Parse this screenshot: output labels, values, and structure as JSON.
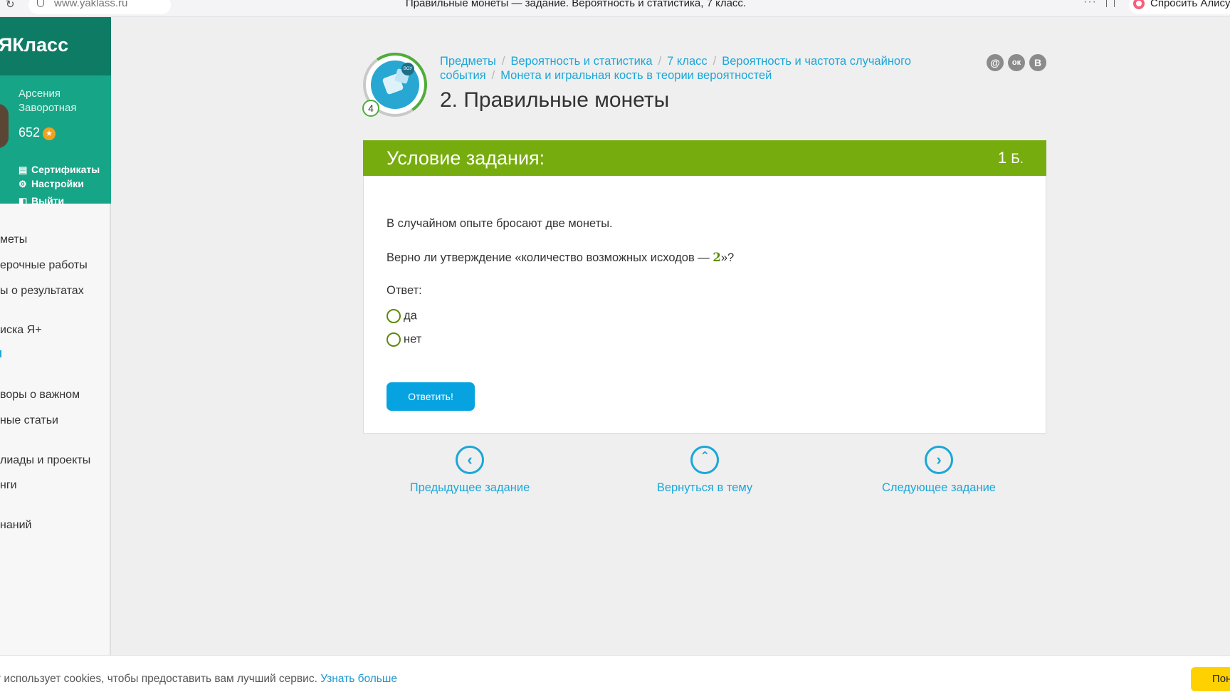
{
  "browser": {
    "url": "www.yaklass.ru",
    "tab_title": "Правильные монеты — задание. Вероятность и статистика, 7 класс.",
    "alice_label": "Спросить Алису"
  },
  "sidebar": {
    "logo": "ЯКласс",
    "user_name": "Арсения Заворотная",
    "points": "652",
    "links": [
      {
        "label": "Сертификаты",
        "icon": "certificate-icon"
      },
      {
        "label": "Настройки",
        "icon": "gear-icon"
      },
      {
        "label": "Выйти",
        "icon": "logout-icon"
      }
    ],
    "nav": [
      "меты",
      "ерочные работы",
      "ы о результатах",
      "иска Я+",
      "воры о важном",
      "ные статьи",
      "лиады и проекты",
      "нги",
      "наний"
    ]
  },
  "header": {
    "topic_level": "4",
    "breadcrumb": [
      "Предметы",
      "Вероятность и статистика",
      "7 класс",
      "Вероятность и частота случайного события",
      "Монета и игральная кость в теории вероятностей"
    ],
    "title": "2. Правильные монеты",
    "share": [
      "@",
      "ок",
      "В"
    ]
  },
  "task": {
    "heading": "Условие задания:",
    "points_value": "1",
    "points_unit": "Б.",
    "statement": "В случайном опыте бросают две монеты.",
    "question_before": "Верно ли утверждение «количество возможных исходов — ",
    "question_number": "2",
    "question_after": "»?",
    "answer_label": "Ответ:",
    "options": [
      "да",
      "нет"
    ],
    "submit_label": "Ответить!"
  },
  "navigation": {
    "prev": "Предыдущее задание",
    "back": "Вернуться в тему",
    "next": "Следующее задание"
  },
  "cookie": {
    "text": "т использует cookies, чтобы предоставить вам лучший сервис.",
    "link": "Узнать больше",
    "button": "Пон"
  }
}
